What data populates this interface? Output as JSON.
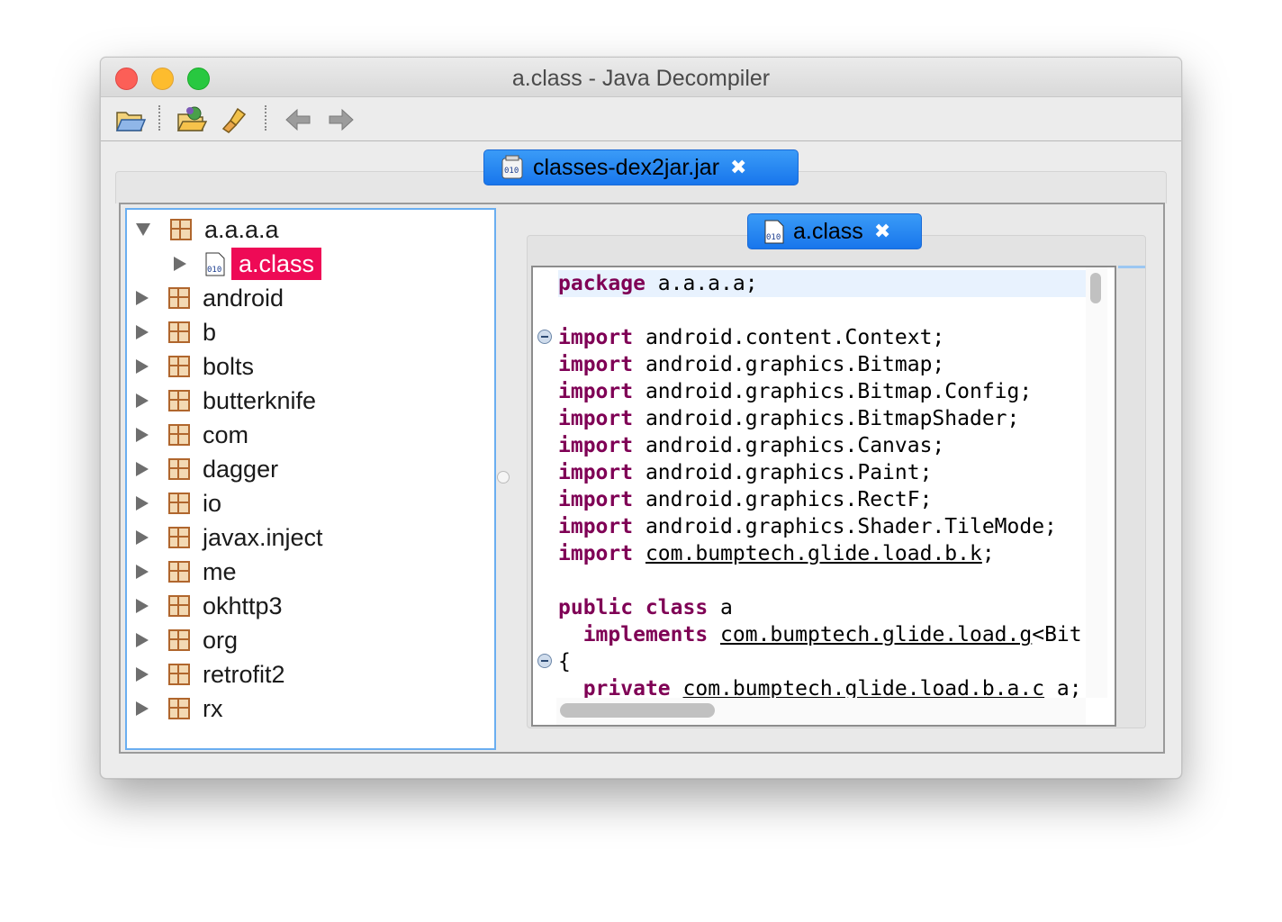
{
  "window": {
    "title": "a.class - Java Decompiler"
  },
  "toolbar": {
    "open_file_icon": "open-folder-icon",
    "open_type_icon": "open-type-icon",
    "search_icon": "search-brush-icon",
    "back_icon": "back-arrow-icon",
    "forward_icon": "forward-arrow-icon"
  },
  "outer_tab": {
    "label": "classes-dex2jar.jar",
    "close": "✖"
  },
  "editor_tab": {
    "label": "a.class",
    "close": "✖"
  },
  "tree": {
    "root_expanded": "a.a.a.a",
    "selected_child": "a.class",
    "packages": [
      "android",
      "b",
      "bolts",
      "butterknife",
      "com",
      "dagger",
      "io",
      "javax.inject",
      "me",
      "okhttp3",
      "org",
      "retrofit2",
      "rx"
    ]
  },
  "code": {
    "line1_kw": "package",
    "line1_rest": " a.a.a.a;",
    "import_kw": "import",
    "imports": [
      " android.content.Context;",
      " android.graphics.Bitmap;",
      " android.graphics.Bitmap.Config;",
      " android.graphics.BitmapShader;",
      " android.graphics.Canvas;",
      " android.graphics.Paint;",
      " android.graphics.RectF;",
      " android.graphics.Shader.TileMode;"
    ],
    "last_import_link": "com.bumptech.glide.load.b.k",
    "last_import_end": ";",
    "class_kw": "public class",
    "class_name": " a",
    "implements_kw": "implements",
    "implements_link": "com.bumptech.glide.load.g",
    "implements_rest": "<Bit",
    "brace": "{",
    "private_kw": "private",
    "private_link": "com.bumptech.glide.load.b.a.c",
    "private_rest": " a;"
  }
}
